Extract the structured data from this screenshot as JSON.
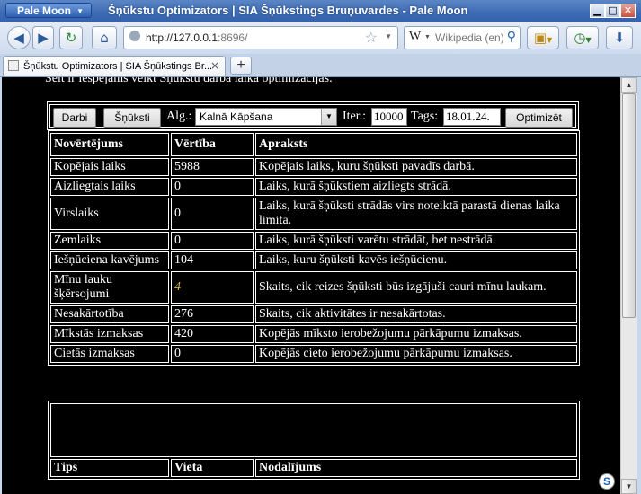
{
  "window": {
    "app_menu_label": "Pale Moon",
    "title": "Šņūkstu Optimizators | SIA Šņūkstings Bruņuvardes - Pale Moon",
    "minimize_glyph": "▁",
    "maximize_glyph": "□",
    "close_glyph": "✕"
  },
  "nav": {
    "back_glyph": "◀",
    "forward_glyph": "▶",
    "reload_glyph": "↻",
    "home_glyph": "⌂",
    "url_host": "http://127.0.0.1",
    "url_port": ":8696/",
    "search_engine_glyph": "W",
    "search_placeholder": "Wikipedia (en)",
    "search_glyph": "⚲",
    "bookmark_star": "☆",
    "download_glyph": "⬇"
  },
  "tab": {
    "title": "Šņūkstu Optimizators | SIA Šņūkstings Br...",
    "close_glyph": "×",
    "new_tab_glyph": "+"
  },
  "page": {
    "intro": "Šeit ir iespējams veikt Šņūkstu darba laika optimizācijas.",
    "toolbar": {
      "darbi_label": "Darbi",
      "snuksti_label": "Šņūksti",
      "alg_label": "Alg.:",
      "alg_value": "Kalnā Kāpšana",
      "iter_label": "Iter.:",
      "iter_value": "10000",
      "tags_label": "Tags:",
      "tags_value": "18.01.24.",
      "optimize_label": "Optimizēt"
    },
    "table_headers": [
      "Novērtējums",
      "Vērtība",
      "Apraksts"
    ],
    "rows": [
      {
        "name": "Kopējais laiks",
        "value": "5988",
        "desc": "Kopējais laiks, kuru šņūksti pavadīs darbā."
      },
      {
        "name": "Aizliegtais laiks",
        "value": "0",
        "desc": "Laiks, kurā šņūkstiem aizliegts strādā."
      },
      {
        "name": "Virslaiks",
        "value": "0",
        "desc": "Laiks, kurā šņūksti strādās virs noteiktā parastā dienas laika limita."
      },
      {
        "name": "Zemlaiks",
        "value": "0",
        "desc": "Laiks, kurā šņūksti varētu strādāt, bet nestrādā."
      },
      {
        "name": "Iešņūciena kavējums",
        "value": "104",
        "desc": "Laiks, kuru šņūksti kavēs iešņūcienu."
      },
      {
        "name": "Mīnu lauku šķērsojumi",
        "value": "4",
        "desc": "Skaits, cik reizes šņūksti būs izgājuši cauri mīnu laukam."
      },
      {
        "name": "Nesakārtotība",
        "value": "276",
        "desc": "Skaits, cik aktivitātes ir nesakārtotas."
      },
      {
        "name": "Mīkstās izmaksas",
        "value": "420",
        "desc": "Kopējās mīksto ierobežojumu pārkāpumu izmaksas."
      },
      {
        "name": "Cietās izmaksas",
        "value": "0",
        "desc": "Kopējās cieto ierobežojumu pārkāpumu izmaksas."
      }
    ],
    "bottom_headers": [
      "Tips",
      "Vieta",
      "Nodalījums"
    ]
  },
  "status": {
    "addon_icon_glyph": "S"
  }
}
